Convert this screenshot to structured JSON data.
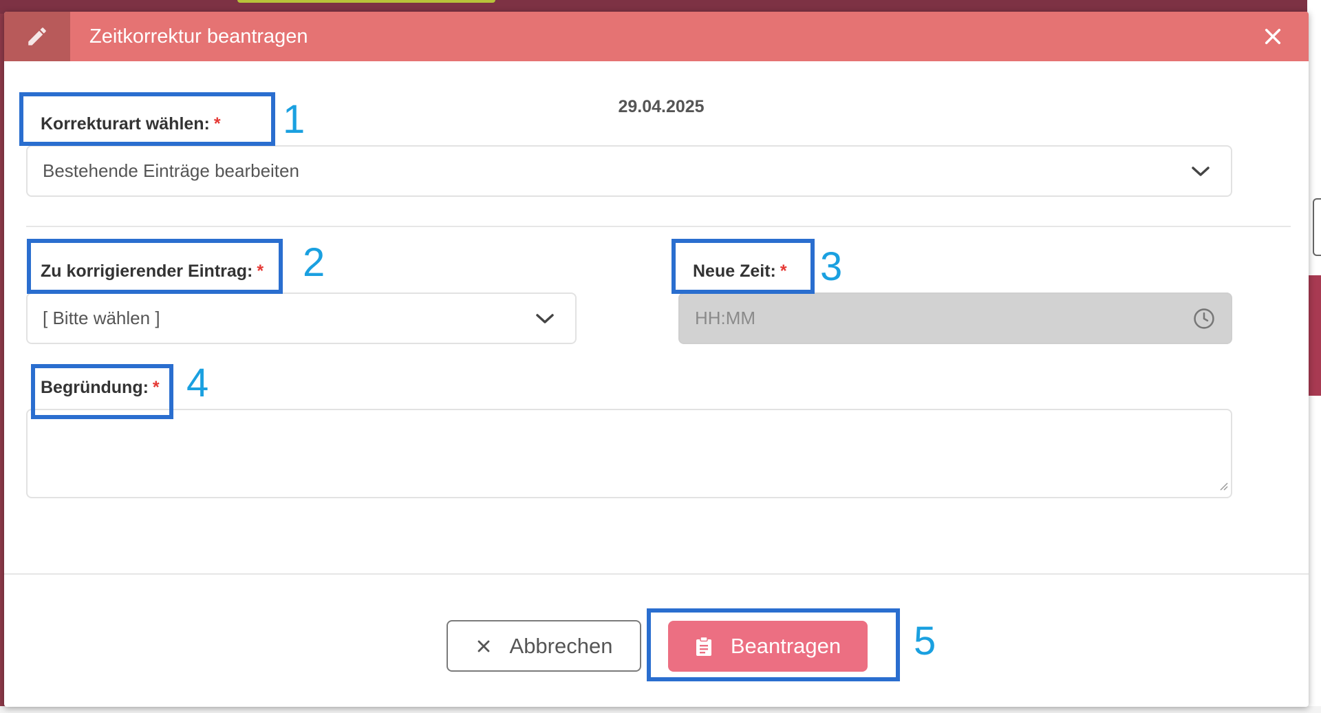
{
  "dialog": {
    "title": "Zeitkorrektur beantragen",
    "header_icon": "pencil-icon",
    "close_icon": "close-icon",
    "header_color": "#e57373"
  },
  "date": "29.04.2025",
  "fields": {
    "correction_type": {
      "label": "Korrekturart wählen:",
      "required_mark": "*",
      "value": "Bestehende Einträge bearbeiten"
    },
    "entry": {
      "label": "Zu korrigierender Eintrag:",
      "required_mark": "*",
      "value": "[ Bitte wählen ]"
    },
    "new_time": {
      "label": "Neue Zeit:",
      "required_mark": "*",
      "placeholder": "HH:MM",
      "icon": "clock-icon"
    },
    "reason": {
      "label": "Begründung:",
      "required_mark": "*",
      "value": ""
    }
  },
  "buttons": {
    "cancel": {
      "label": "Abbrechen",
      "icon": "close-icon"
    },
    "submit": {
      "label": "Beantragen",
      "icon": "clipboard-icon",
      "color": "#ec6f82"
    }
  },
  "annotations": [
    "1",
    "2",
    "3",
    "4",
    "5"
  ],
  "colors": {
    "required": "#e53935",
    "annotation_box": "#2a6ecf",
    "annotation_number": "#1aa0e0"
  }
}
